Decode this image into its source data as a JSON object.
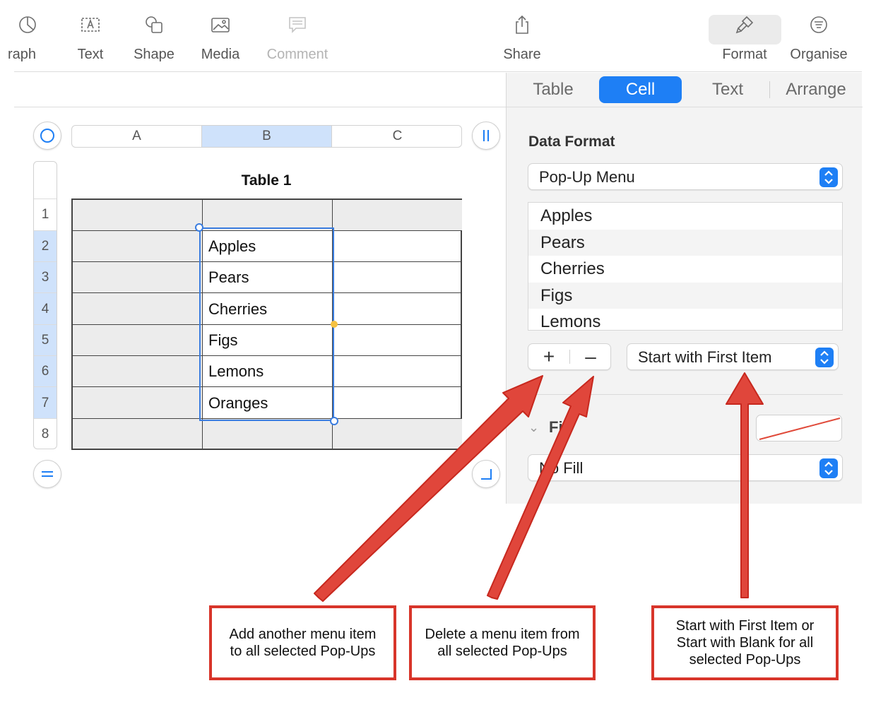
{
  "toolbar": {
    "items": [
      {
        "label": "raph",
        "icon": "chart-icon"
      },
      {
        "label": "Text",
        "icon": "text-box-icon"
      },
      {
        "label": "Shape",
        "icon": "shape-icon"
      },
      {
        "label": "Media",
        "icon": "image-icon"
      },
      {
        "label": "Comment",
        "icon": "comment-icon",
        "disabled": true
      },
      {
        "label": "Share",
        "icon": "share-icon"
      },
      {
        "label": "Format",
        "icon": "paintbrush-icon",
        "selected": true
      },
      {
        "label": "Organise",
        "icon": "organise-icon"
      }
    ]
  },
  "inspector": {
    "tabs": [
      "Table",
      "Cell",
      "Text",
      "Arrange"
    ],
    "active_tab": "Cell",
    "data_format_title": "Data Format",
    "data_format_value": "Pop-Up Menu",
    "menu_items": [
      "Apples",
      "Pears",
      "Cherries",
      "Figs",
      "Lemons"
    ],
    "add_label": "+",
    "remove_label": "–",
    "start_option": "Start with First Item",
    "fill_title": "Fill",
    "fill_value": "No Fill"
  },
  "sheet": {
    "column_headers": [
      "A",
      "B",
      "C"
    ],
    "selected_column": "B",
    "row_headers": [
      "1",
      "2",
      "3",
      "4",
      "5",
      "6",
      "7",
      "8"
    ],
    "selected_rows": [
      "2",
      "3",
      "4",
      "5",
      "6",
      "7"
    ],
    "table_title": "Table 1",
    "column_b_values": [
      "",
      "Apples",
      "Pears",
      "Cherries",
      "Figs",
      "Lemons",
      "Oranges",
      ""
    ]
  },
  "callouts": {
    "add": "Add another menu item to all selected Pop-Ups",
    "delete": "Delete a menu item from all selected Pop-Ups",
    "start": "Start with First Item or Start with Blank for all selected Pop-Ups"
  },
  "colors": {
    "accent": "#1e7ff5",
    "selection": "#3a7de0",
    "callout_red": "#d8352a"
  }
}
